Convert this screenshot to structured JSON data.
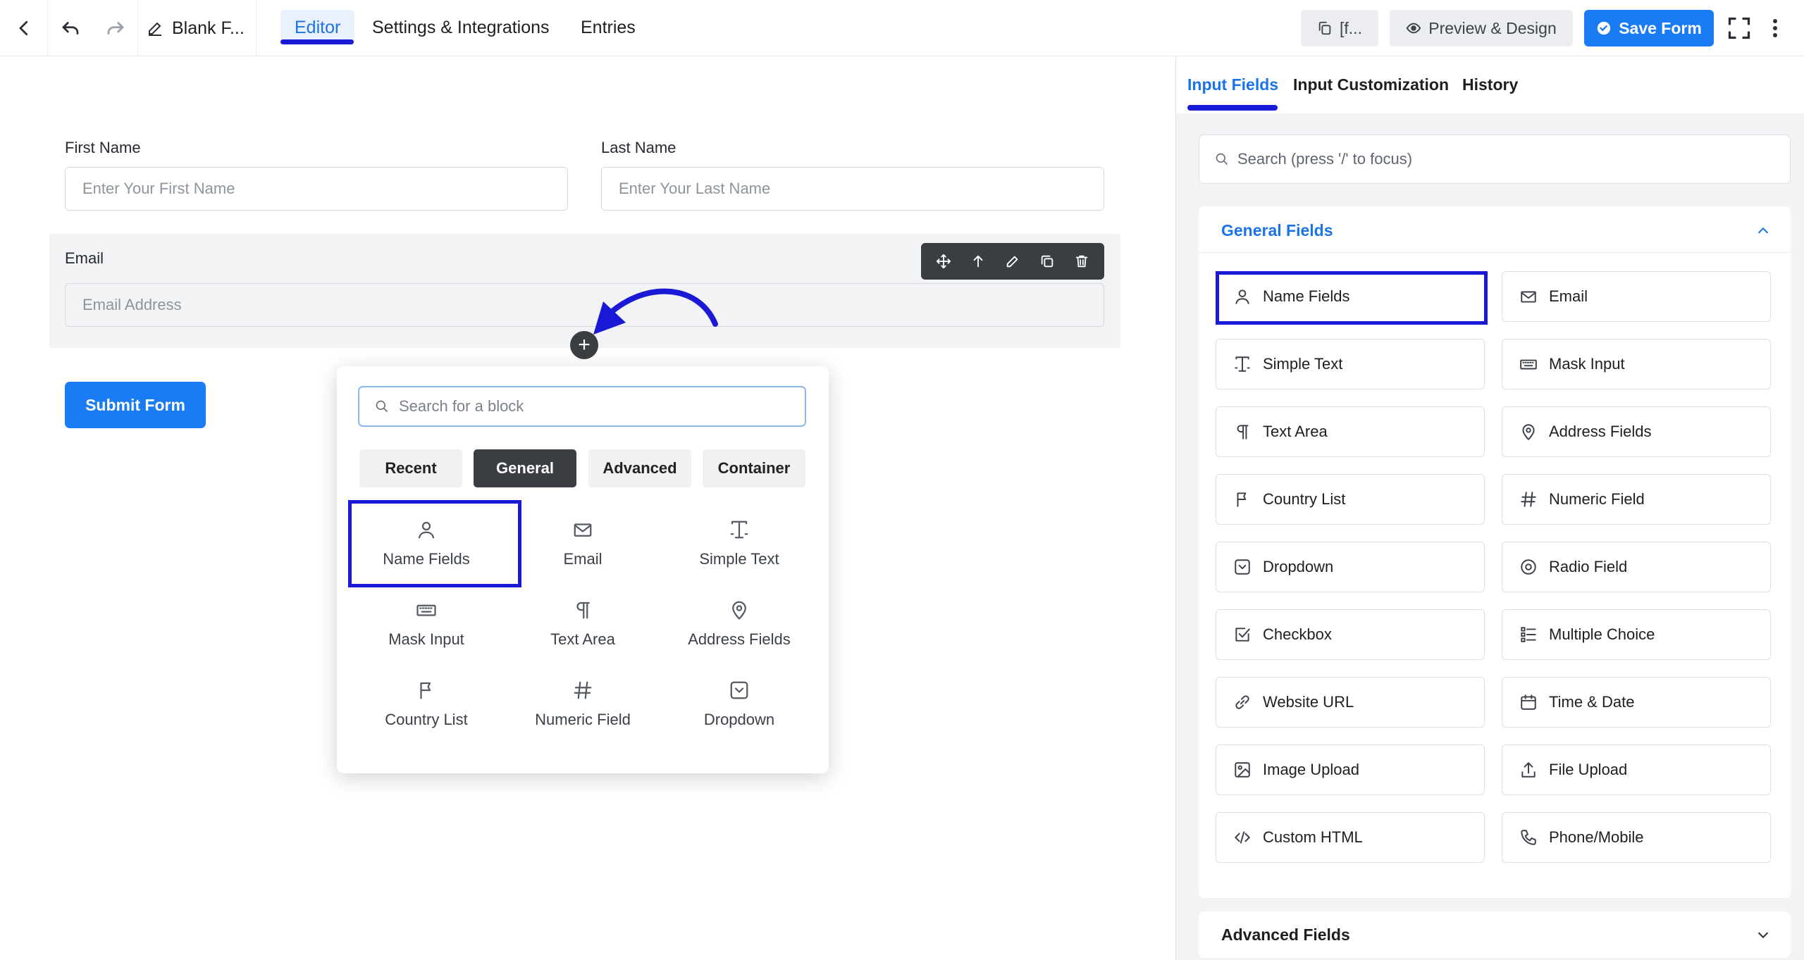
{
  "topbar": {
    "form_title": "Blank F...",
    "tabs": [
      "Editor",
      "Settings & Integrations",
      "Entries"
    ],
    "shortcode_label": "[f...",
    "preview_label": "Preview & Design",
    "save_label": "Save Form"
  },
  "form": {
    "first_name_label": "First Name",
    "first_name_placeholder": "Enter Your First Name",
    "last_name_label": "Last Name",
    "last_name_placeholder": "Enter Your Last Name",
    "email_label": "Email",
    "email_placeholder": "Email Address",
    "submit_label": "Submit Form"
  },
  "popup": {
    "search_placeholder": "Search for a block",
    "tabs": [
      "Recent",
      "General",
      "Advanced",
      "Container"
    ],
    "blocks": [
      "Name Fields",
      "Email",
      "Simple Text",
      "Mask Input",
      "Text Area",
      "Address Fields",
      "Country List",
      "Numeric Field",
      "Dropdown"
    ]
  },
  "panel": {
    "tabs": [
      "Input Fields",
      "Input Customization",
      "History"
    ],
    "search_placeholder": "Search (press '/' to focus)",
    "general_title": "General Fields",
    "fields": [
      "Name Fields",
      "Email",
      "Simple Text",
      "Mask Input",
      "Text Area",
      "Address Fields",
      "Country List",
      "Numeric Field",
      "Dropdown",
      "Radio Field",
      "Checkbox",
      "Multiple Choice",
      "Website URL",
      "Time & Date",
      "Image Upload",
      "File Upload",
      "Custom HTML",
      "Phone/Mobile"
    ],
    "advanced_title": "Advanced Fields"
  },
  "colors": {
    "accent": "#1a73e8",
    "primary_button": "#1a7cf5",
    "annotation": "#1a1ad6"
  }
}
